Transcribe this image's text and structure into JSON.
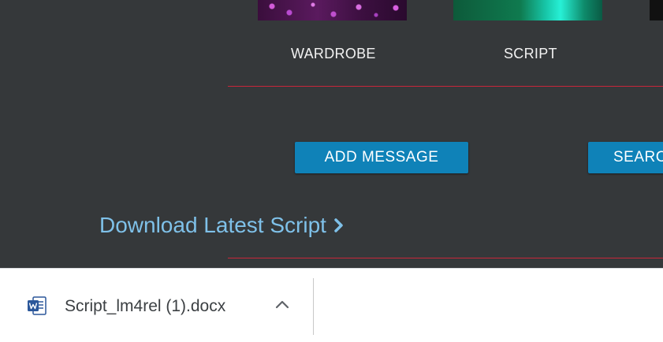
{
  "categories": {
    "wardrobe_label": "WARDROBE",
    "script_label": "SCRIPT"
  },
  "buttons": {
    "add_message_label": "ADD MESSAGE",
    "search_label": "SEARCH"
  },
  "download_link": {
    "text": "Download Latest Script",
    "icon": "chevron-right-icon"
  },
  "download_bar": {
    "items": [
      {
        "filename": "Script_lm4rel (1).docx",
        "icon": "word-document-icon",
        "menu_icon": "chevron-up-icon"
      }
    ]
  },
  "colors": {
    "page_background": "#35383a",
    "button_blue": "#0f82b8",
    "divider_red": "#c8263a",
    "link_blue": "#7fc1e9",
    "download_bar_background": "#ffffff",
    "word_blue": "#2b579a"
  }
}
